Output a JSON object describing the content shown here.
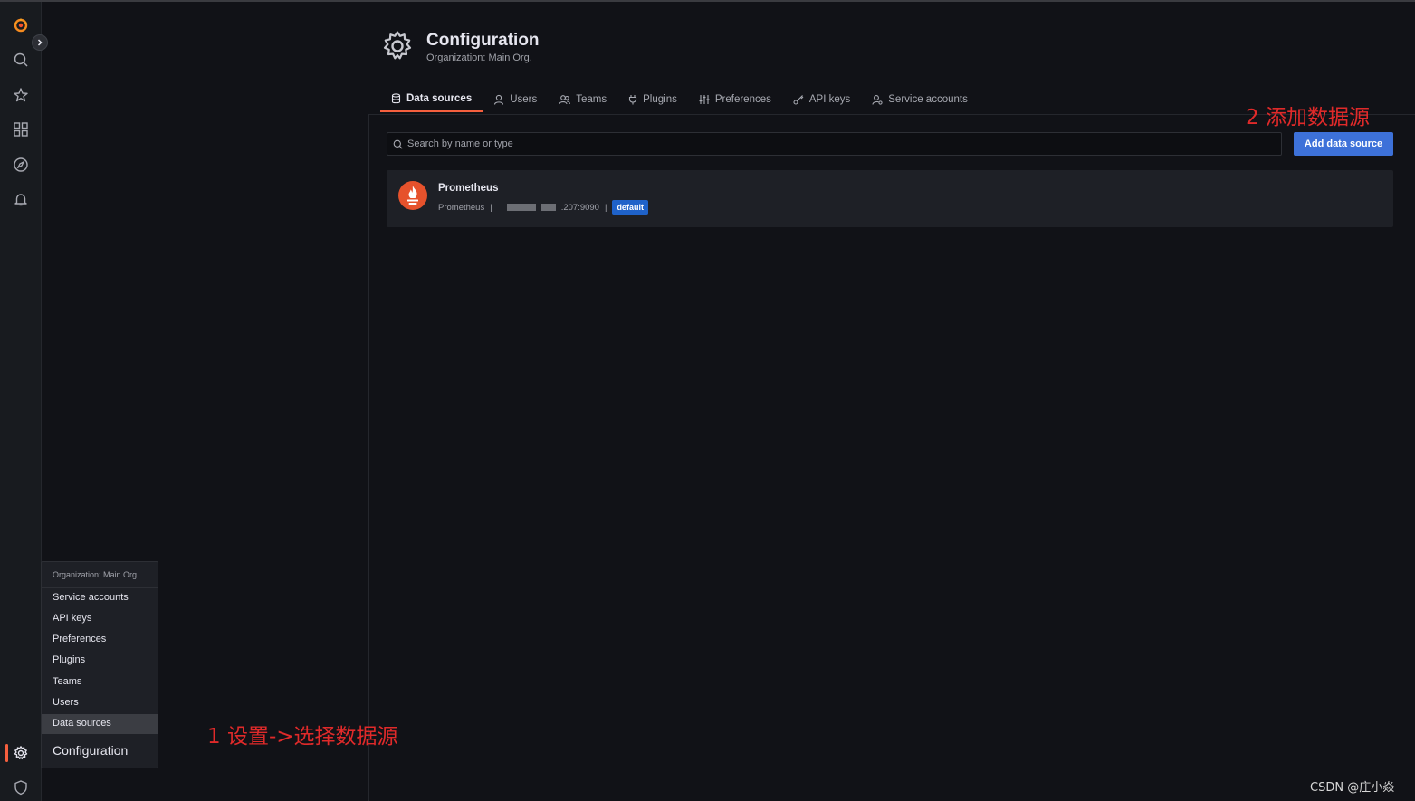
{
  "header": {
    "title": "Configuration",
    "subtitle": "Organization: Main Org."
  },
  "tabs": [
    {
      "label": "Data sources",
      "icon": "database-icon",
      "active": true
    },
    {
      "label": "Users",
      "icon": "user-icon"
    },
    {
      "label": "Teams",
      "icon": "users-icon"
    },
    {
      "label": "Plugins",
      "icon": "plug-icon"
    },
    {
      "label": "Preferences",
      "icon": "sliders-icon"
    },
    {
      "label": "API keys",
      "icon": "key-icon"
    },
    {
      "label": "Service accounts",
      "icon": "user-cog-icon"
    }
  ],
  "search": {
    "placeholder": "Search by name or type"
  },
  "add_button": {
    "label": "Add data source"
  },
  "datasource": {
    "name": "Prometheus",
    "type": "Prometheus",
    "separator": "|",
    "url_suffix": ".207:9090",
    "badge": "default"
  },
  "menu": {
    "header": "Organization: Main Org.",
    "items": [
      "Service accounts",
      "API keys",
      "Preferences",
      "Plugins",
      "Teams",
      "Users",
      "Data sources"
    ],
    "active_item": "Data sources",
    "footer": "Configuration"
  },
  "annotations": {
    "step1": "1   设置->选择数据源",
    "step2": "2   添加数据源"
  },
  "watermark": "CSDN @庄小焱",
  "colors": {
    "accent": "#f55f3e",
    "primary_button": "#3d71d9",
    "badge": "#1f62c9",
    "annotation": "#e02a2a"
  }
}
